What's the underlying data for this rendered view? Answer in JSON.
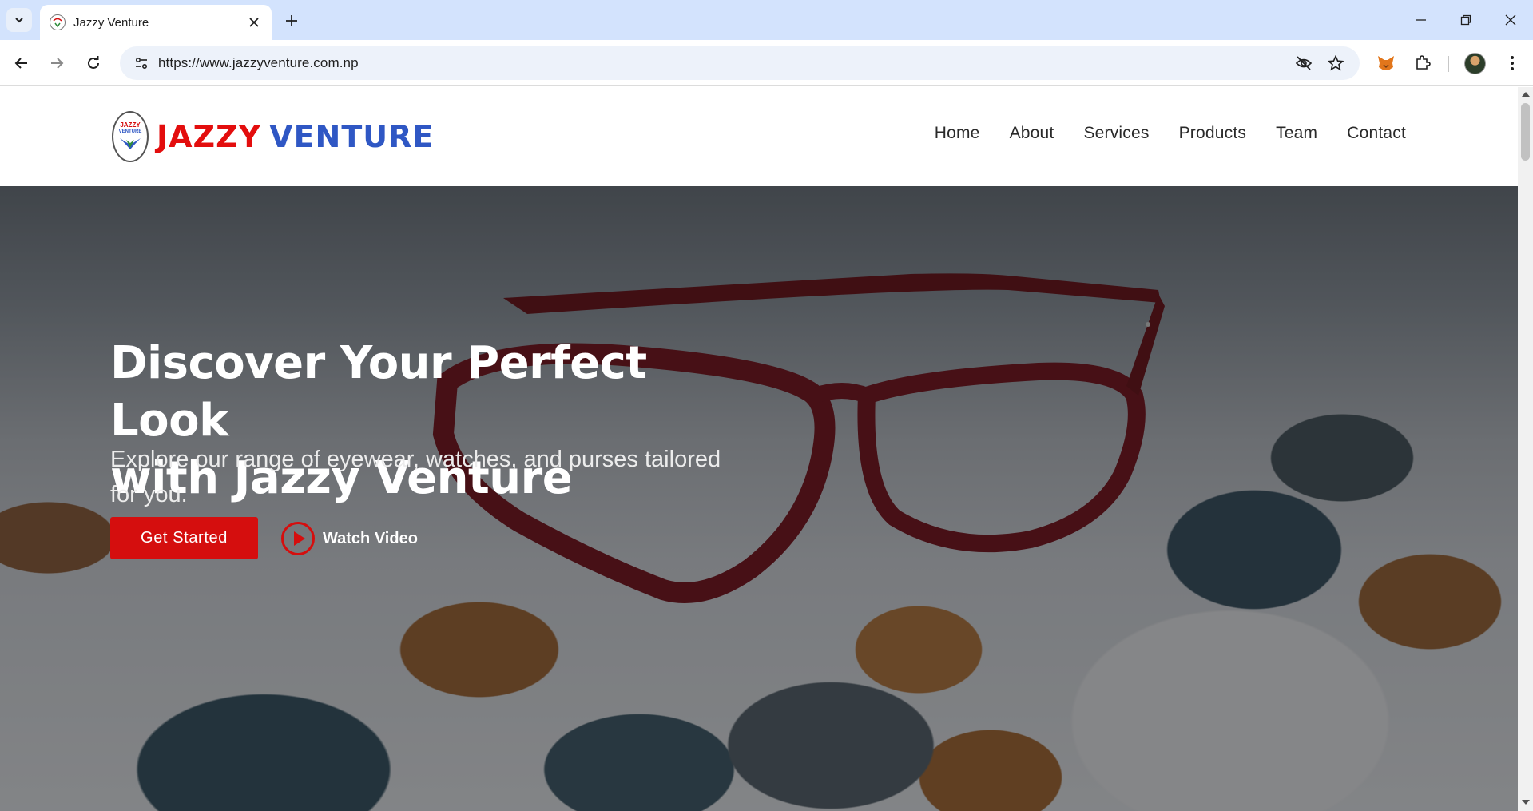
{
  "browser": {
    "tab_title": "Jazzy Venture",
    "url": "https://www.jazzyventure.com.np"
  },
  "site": {
    "logo_word1": "JAZZY",
    "logo_word2": "VENTURE",
    "emblem_text_top": "JAZZY",
    "emblem_text_bottom": "VENTURE",
    "nav": [
      "Home",
      "About",
      "Services",
      "Products",
      "Team",
      "Contact"
    ]
  },
  "hero": {
    "title_line1": "Discover Your Perfect Look",
    "title_line2": "with Jazzy Venture",
    "subtitle": "Explore our range of eyewear, watches, and purses tailored for you.",
    "cta_primary": "Get Started",
    "cta_secondary": "Watch Video"
  },
  "colors": {
    "brand_red": "#d50e0e",
    "brand_blue": "#2f57c4",
    "chrome_tabbar": "#d3e3fd"
  },
  "icons": [
    "tab-search-icon",
    "site-favicon-icon",
    "close-icon",
    "plus-icon",
    "minimize-icon",
    "restore-icon",
    "window-close-icon",
    "back-icon",
    "forward-icon",
    "reload-icon",
    "site-info-icon",
    "eye-slash-icon",
    "star-icon",
    "metamask-fox-icon",
    "puzzle-icon",
    "kebab-menu-icon",
    "play-icon"
  ]
}
